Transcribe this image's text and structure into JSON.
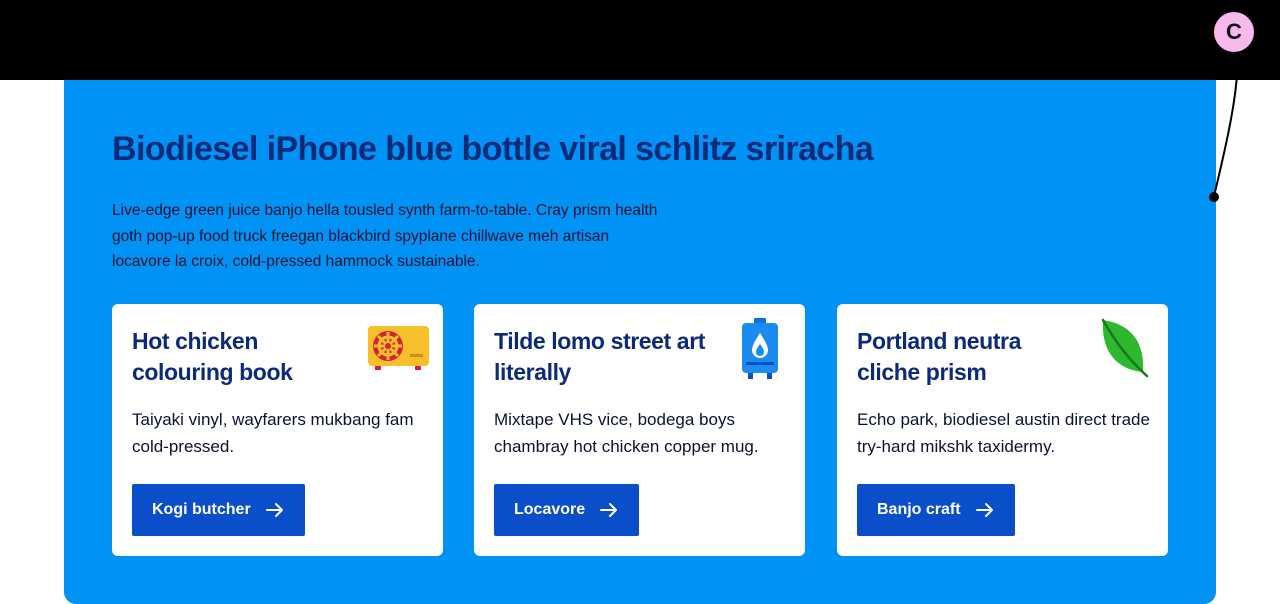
{
  "hero": {
    "title": "Biodiesel iPhone blue bottle viral schlitz sriracha",
    "description": "Live-edge green juice banjo hella tousled synth farm-to-table. Cray prism health goth pop-up food truck freegan blackbird spyplane chillwave meh artisan locavore la croix, cold-pressed hammock sustainable."
  },
  "cards": [
    {
      "title": "Hot chicken colouring book",
      "description": "Taiyaki vinyl, wayfarers mukbang fam cold-pressed.",
      "button_label": "Kogi butcher",
      "icon": "safe-icon"
    },
    {
      "title": "Tilde lomo street art literally",
      "description": "Mixtape VHS vice, bodega boys chambray hot chicken copper mug.",
      "button_label": "Locavore",
      "icon": "water-heater-icon"
    },
    {
      "title": "Portland neutra cliche prism",
      "description": "Echo park, biodiesel austin direct trade try-hard mikshk taxidermy.",
      "button_label": "Banjo craft",
      "icon": "leaf-icon"
    }
  ],
  "annotation": {
    "badge_label": "C"
  },
  "colors": {
    "panel_background": "#0093f5",
    "heading_text": "#0b2a78",
    "button_background": "#0a4ec9",
    "top_bar": "#000000",
    "badge_background": "#f7b8ec"
  }
}
